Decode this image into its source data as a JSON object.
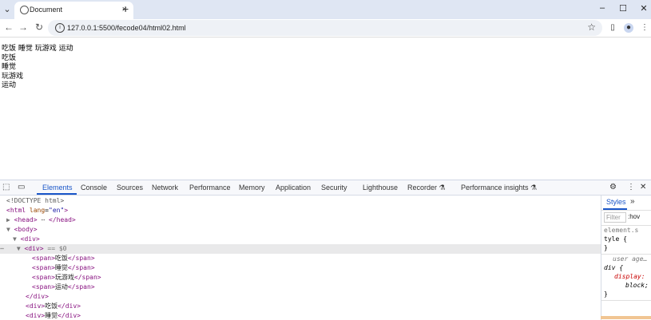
{
  "browser": {
    "tab_title": "Document",
    "tab_close": "×",
    "new_tab": "+",
    "url": "127.0.0.1:5500/fecode04/html02.html",
    "window_buttons": [
      "–",
      "☐",
      "✕"
    ]
  },
  "page": {
    "lines": [
      "吃饭 睡觉 玩游戏 运动",
      "吃饭",
      "睡觉",
      "玩游戏",
      "运动"
    ]
  },
  "devtools": {
    "tabs": [
      "Elements",
      "Console",
      "Sources",
      "Network",
      "Performance",
      "Memory",
      "Application",
      "Security",
      "Lighthouse",
      "Recorder ⚗",
      "Performance insights ⚗"
    ],
    "active_tab": "Elements",
    "dom": [
      {
        "doctype": "<!DOCTYPE html>"
      },
      {
        "open": "<html ",
        "attr": "lang",
        "val": "\"en\"",
        "close": ">"
      },
      {
        "open": "<head>",
        "ellipsis": "⋯",
        "end": "</head>"
      },
      {
        "open": "<body>"
      },
      {
        "open": "<div>"
      },
      {
        "open": "<div>",
        "sel": "== $0"
      },
      {
        "open": "<span>",
        "text": "吃饭",
        "end": "</span>"
      },
      {
        "open": "<span>",
        "text": "睡觉",
        "end": "</span>"
      },
      {
        "open": "<span>",
        "text": "玩游戏",
        "end": "</span>"
      },
      {
        "open": "<span>",
        "text": "运动",
        "end": "</span>"
      },
      {
        "open": "</div>"
      },
      {
        "open": "<div>",
        "text": "吃饭",
        "end": "</div>"
      },
      {
        "open": "<div>",
        "text": "睡觉",
        "end": "</div>"
      }
    ],
    "styles": {
      "tab": "Styles",
      "more": "»",
      "filter_placeholder": "Filter",
      "hov": ":hov",
      "element_style": [
        "element.s",
        "tyle {",
        "}"
      ],
      "ua_rule": [
        "user age…",
        "div {",
        "display:",
        "block;",
        "}"
      ]
    }
  }
}
